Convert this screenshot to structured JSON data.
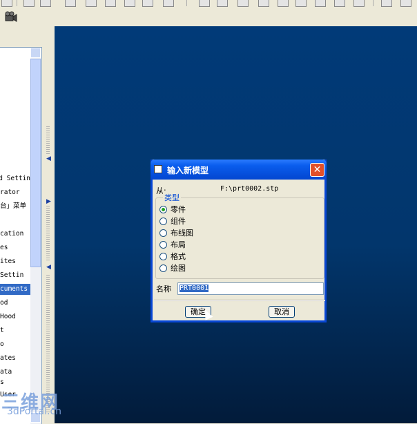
{
  "left_tree": {
    "items": [
      {
        "label": "d Settin",
        "selected": false
      },
      {
        "label": "rator",
        "selected": false
      },
      {
        "label": "台」菜单",
        "selected": false
      },
      {
        "label": "",
        "selected": false
      },
      {
        "label": "cation",
        "selected": false
      },
      {
        "label": "es",
        "selected": false
      },
      {
        "label": "ites",
        "selected": false
      },
      {
        "label": "Settin",
        "selected": false
      },
      {
        "label": "cuments",
        "selected": true
      },
      {
        "label": "od",
        "selected": false
      },
      {
        "label": "Hood",
        "selected": false
      },
      {
        "label": "t",
        "selected": false
      },
      {
        "label": "o",
        "selected": false
      },
      {
        "label": "ates",
        "selected": false
      },
      {
        "label": "ata",
        "selected": false
      },
      {
        "label": "s",
        "selected": false
      },
      {
        "label": "User",
        "selected": false
      }
    ]
  },
  "dialog": {
    "title": "输入新模型",
    "close_label": "✕",
    "from_label": "从:",
    "from_value": "F:\\prt0002.stp",
    "type_group_label": "类型",
    "types": [
      {
        "label": "零件",
        "selected": true
      },
      {
        "label": "组件",
        "selected": false
      },
      {
        "label": "布线图",
        "selected": false
      },
      {
        "label": "布局",
        "selected": false
      },
      {
        "label": "格式",
        "selected": false
      },
      {
        "label": "绘图",
        "selected": false
      }
    ],
    "name_label": "名称",
    "name_value": "PRT0001",
    "ok_label": "确定",
    "cancel_label": "取消"
  },
  "watermark": {
    "main": "三维网",
    "sub": "3dPortal.cn"
  },
  "colors": {
    "viewport_top": "#013a78",
    "viewport_bottom": "#021b3a",
    "title_bar": "#0a5ded",
    "selection": "#316ac5",
    "close_button": "#e2502a"
  }
}
